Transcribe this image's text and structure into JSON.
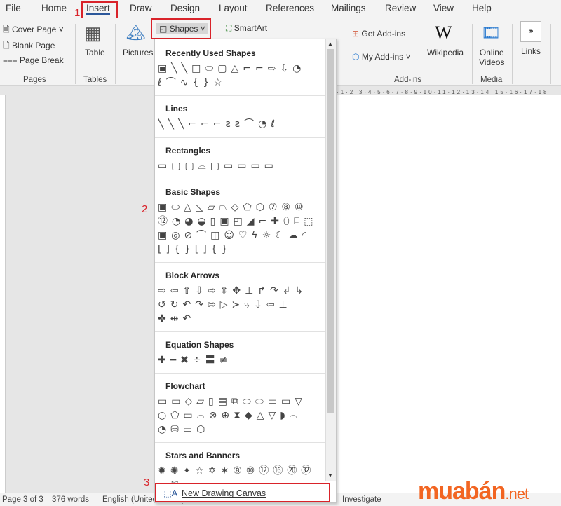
{
  "tabs": [
    "File",
    "Home",
    "Insert",
    "Draw",
    "Design",
    "Layout",
    "References",
    "Mailings",
    "Review",
    "View",
    "Help"
  ],
  "annotations": {
    "one": "1",
    "two": "2",
    "three": "3"
  },
  "ribbon": {
    "cover_page": "Cover Page",
    "blank_page": "Blank Page",
    "page_break": "Page Break",
    "pages_group": "Pages",
    "table": "Table",
    "tables_group": "Tables",
    "pictures": "Pictures",
    "shapes": "Shapes",
    "smartart": "SmartArt",
    "get_addins": "Get Add-ins",
    "my_addins": "My Add-ins",
    "wikipedia": "Wikipedia",
    "addins_group": "Add-ins",
    "online_videos_1": "Online",
    "online_videos_2": "Videos",
    "media_group": "Media",
    "links": "Links"
  },
  "ruler": "·1·2·3·4·5·6·7·8·9·10·11·12·13·14·15·16·17·18",
  "shapes_menu": {
    "sections": [
      {
        "title": "Recently Used Shapes",
        "rows": [
          "▣╲╲□⬭▢△⌐⌐⇨⇩◔",
          "ℓ⌒∿{}☆"
        ]
      },
      {
        "title": "Lines",
        "rows": [
          "╲╲╲⌐⌐⌐ƨƨ⌒◔ℓ"
        ]
      },
      {
        "title": "Rectangles",
        "rows": [
          "▭▢▢⌓▢▭▭▭▭"
        ]
      },
      {
        "title": "Basic Shapes",
        "rows": [
          "▣⬭△◺▱⏢◇⬠⬡⑦⑧⑩",
          "⑫◔◕◒▯▣◰◢⌐✚⬯⌸⬚",
          "▣◎⊘⌒◫☺♡ϟ☼☾☁◜",
          "[]{}[]{}"
        ]
      },
      {
        "title": "Block Arrows",
        "rows": [
          "⇨⇦⇧⇩⬄⇳✥⊥↱↷↲↳",
          "↺↻↶↷⇰▷≻⤷⇩⇦⊥",
          "✤⇹↶"
        ]
      },
      {
        "title": "Equation Shapes",
        "rows": [
          "✚━✖÷〓≠"
        ]
      },
      {
        "title": "Flowchart",
        "rows": [
          "▭▭◇▱▯▤⧉⬭⬭▭▭▽",
          "○⬠▭⌓⊗⊕⧗◆△▽◗⌓",
          "◔⛁▭⬡"
        ]
      },
      {
        "title": "Stars and Banners",
        "rows": [
          "✹✺✦☆✡✶⑧⑩⑫⑯⑳㉜",
          "▭⛿▭▭▭▭▭▭"
        ]
      }
    ],
    "new_drawing_canvas": "New Drawing Canvas"
  },
  "status": {
    "page": "Page 3 of 3",
    "words": "376 words",
    "language": "English (United States)",
    "investigate": "Investigate"
  },
  "logo": {
    "text": "muabán",
    ".net": ".net"
  },
  "colors": {
    "accent": "#2b579a",
    "annotation": "#d9232a",
    "logo": "#f26522"
  }
}
